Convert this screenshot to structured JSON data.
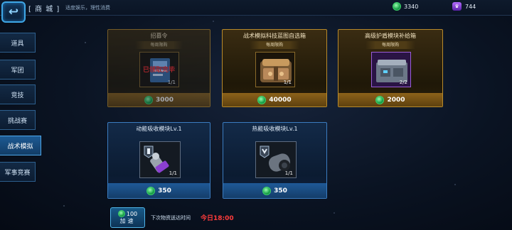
{
  "header": {
    "title": "[ 商 城 ]",
    "subtitle": "适度娱乐，理性消费",
    "currency_green": "3340",
    "currency_purple": "744"
  },
  "sidebar": {
    "items": [
      {
        "label": "道具",
        "active": false
      },
      {
        "label": "军团",
        "active": false
      },
      {
        "label": "竞技",
        "active": false
      },
      {
        "label": "挑战赛",
        "active": false
      },
      {
        "label": "战术模拟",
        "active": true
      },
      {
        "label": "军事竞赛",
        "active": false
      }
    ]
  },
  "items": [
    {
      "name": "招募令",
      "limit": "每周限购",
      "qty": "1/1",
      "price": "3000",
      "style": "gold",
      "sold_out": true,
      "sold_label": "已领取完毕"
    },
    {
      "name": "战术模拟科技蓝图自选箱",
      "limit": "每周限购",
      "qty": "1/1",
      "price": "40000",
      "style": "gold",
      "sold_out": false
    },
    {
      "name": "高级护盾模块补给箱",
      "limit": "每周限购",
      "qty": "2/2",
      "price": "2000",
      "style": "gold",
      "sold_out": false
    },
    {
      "name": "动能吸收模块Lv.1",
      "limit": "",
      "qty": "1/1",
      "price": "350",
      "style": "blue",
      "sold_out": false
    },
    {
      "name": "热能吸收模块Lv.1",
      "limit": "",
      "qty": "1/1",
      "price": "350",
      "style": "blue",
      "sold_out": false
    }
  ],
  "footer": {
    "speed_cost": "100",
    "speed_label": "加速",
    "next_delivery_label": "下次物资送达时间",
    "next_delivery_time": "今日18:00"
  },
  "colors": {
    "gold_border": "#b88a2b",
    "blue_border": "#3b7cc0",
    "sold_out_red": "#ff2c2c"
  }
}
